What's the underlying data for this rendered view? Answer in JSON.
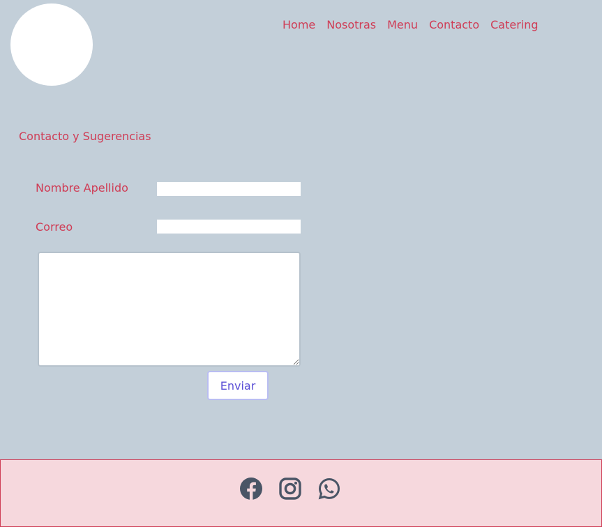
{
  "nav": {
    "items": [
      {
        "label": "Home"
      },
      {
        "label": "Nosotras"
      },
      {
        "label": "Menu"
      },
      {
        "label": "Contacto"
      },
      {
        "label": "Catering"
      }
    ]
  },
  "contact": {
    "title": "Contacto y Sugerencias",
    "name_label": "Nombre Apellido",
    "name_value": "",
    "email_label": "Correo",
    "email_value": "",
    "message_value": "",
    "submit_label": "Enviar"
  },
  "footer": {
    "icons": [
      "facebook-icon",
      "instagram-icon",
      "whatsapp-icon"
    ]
  },
  "colors": {
    "page_background": "#c3cfd9",
    "accent": "#cf3d56",
    "footer_background": "#f6d8dd",
    "icon": "#4a5566",
    "button_text": "#5b4fd6"
  }
}
